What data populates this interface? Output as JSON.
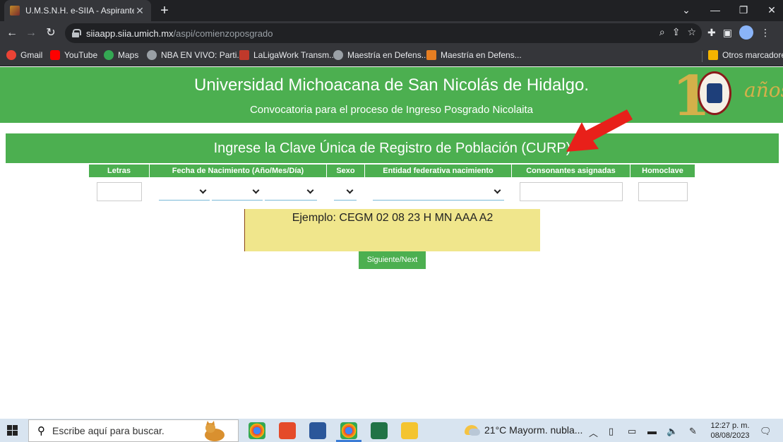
{
  "browser": {
    "tab_title": "U.M.S.N.H. e-SIIA - Aspirantes",
    "tab_close": "✕",
    "new_tab": "+",
    "url_host": "siiaapp.siia.umich.mx",
    "url_path": "/aspi/comienzoposgrado",
    "window_controls": [
      "⌄",
      "—",
      "❐",
      "✕"
    ]
  },
  "bookmarks": [
    {
      "label": "Gmail",
      "icon_color": "#ea4335"
    },
    {
      "label": "YouTube",
      "icon_color": "#ff0000"
    },
    {
      "label": "Maps",
      "icon_color": "#34a853"
    },
    {
      "label": "NBA EN VIVO: Parti...",
      "icon_color": "#9aa0a6"
    },
    {
      "label": "LaLigaWork Transm...",
      "icon_color": "#c0392b"
    },
    {
      "label": "Maestría en Defens...",
      "icon_color": "#9aa0a6"
    },
    {
      "label": "Maestría en Defens...",
      "icon_color": "#e67e22"
    },
    {
      "label": "Otros marcadores",
      "icon_color": "#f4b400"
    }
  ],
  "page": {
    "university": "Universidad Michoacana de San Nicolás de Hidalgo.",
    "subtitle": "Convocatoria para el proceso de Ingreso Posgrado Nicolaita",
    "logo_text_anos": "años",
    "logo_text_100": "1",
    "curp_heading": "Ingrese la Clave Única de Registro de Población (CURP)",
    "columns": {
      "letras": "Letras",
      "fecha": "Fecha de Nacimiento (Año/Mes/Día)",
      "sexo": "Sexo",
      "entidad": "Entidad federativa nacimiento",
      "consonantes": "Consonantes asignadas",
      "homoclave": "Homoclave"
    },
    "fields": {
      "letras_value": "",
      "consonantes_value": "",
      "homoclave_value": ""
    },
    "example": "Ejemplo: CEGM 02 08 23 H MN AAA A2",
    "next_button": "Siguiente/Next",
    "accent_color": "#4caf50"
  },
  "taskbar": {
    "search_placeholder": "Escribe aquí para buscar.",
    "weather": "21°C  Mayorm. nubla...",
    "time": "12:27 p. m.",
    "date": "08/08/2023"
  }
}
